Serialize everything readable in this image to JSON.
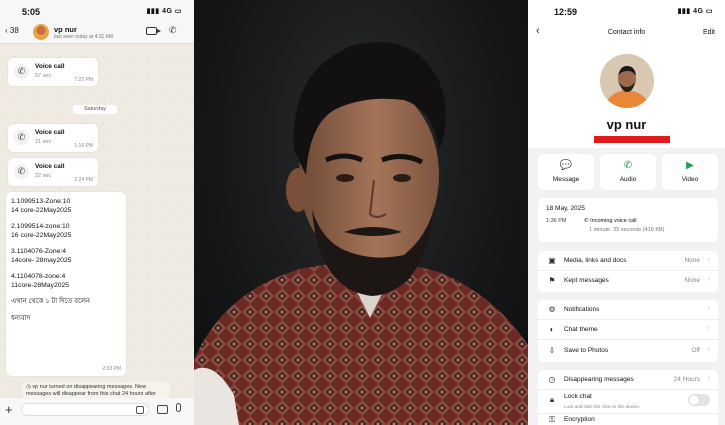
{
  "left_phone": {
    "status": {
      "time": "5:05",
      "signal": "4G"
    },
    "header": {
      "back_count": "38",
      "contact_name": "vp nur",
      "last_seen": "last seen today at 4:31 AM"
    },
    "calls_top": [
      {
        "title": "Voice call",
        "duration": "57 sec",
        "time": "7:22 PM"
      }
    ],
    "day_separator": "Saturday",
    "calls": [
      {
        "title": "Voice call",
        "duration": "21 sec",
        "time": "1:16 PM"
      },
      {
        "title": "Voice call",
        "duration": "22 sec",
        "time": "2:24 PM"
      }
    ],
    "message": {
      "lines": [
        "1.1099513-Zone:10",
        "14 core-22May2025",
        "",
        "2.1099514-zone:10",
        "16 core-22May2025",
        "",
        "3.1104076-Zone:4",
        "14core- 28may2025",
        "",
        "4.1104078-zone:4",
        "11core-28May2025",
        "",
        "এখান থেকে ১ টা দিতে বলেন",
        "",
        "ধন্যবাদ"
      ],
      "time": "2:33 PM"
    },
    "system_notice": "vp nur turned on disappearing messages. New messages will disappear from this chat 24 hours after they're sent."
  },
  "right_phone": {
    "status": {
      "time": "12:59",
      "signal": "4G"
    },
    "header": {
      "title": "Contact info",
      "edit": "Edit"
    },
    "name": "vp nur",
    "actions": [
      {
        "label": "Message",
        "icon": "message-icon",
        "glyph": "💬"
      },
      {
        "label": "Audio",
        "icon": "phone-icon",
        "glyph": "✆"
      },
      {
        "label": "Video",
        "icon": "video-icon",
        "glyph": "▶"
      }
    ],
    "call_log": {
      "date": "18 May, 2025",
      "time": "1:36 PM",
      "type": "Incoming voice call",
      "details": "1 minute, 35 seconds (416 KB)"
    },
    "media_rows": [
      {
        "label": "Media, links and docs",
        "value": "None",
        "icon": "image-icon",
        "glyph": "▣"
      },
      {
        "label": "Kept messages",
        "value": "None",
        "icon": "bookmark-icon",
        "glyph": "⚑"
      }
    ],
    "setting_rows": [
      {
        "label": "Notifications",
        "value": "",
        "icon": "bell-icon",
        "glyph": "⚙"
      },
      {
        "label": "Chat theme",
        "value": "",
        "icon": "palette-icon",
        "glyph": "◐"
      },
      {
        "label": "Save to Photos",
        "value": "Off",
        "icon": "download-icon",
        "glyph": "⇩"
      }
    ],
    "privacy_rows": {
      "disappearing": {
        "label": "Disappearing messages",
        "value": "24 Hours"
      },
      "lock": {
        "label": "Lock chat",
        "sub": "Lock and hide this chat on this device."
      },
      "encryption": {
        "label": "Encryption"
      }
    },
    "colors": {
      "accent": "#1a9e4b",
      "redaction": "#e01b1b"
    }
  }
}
